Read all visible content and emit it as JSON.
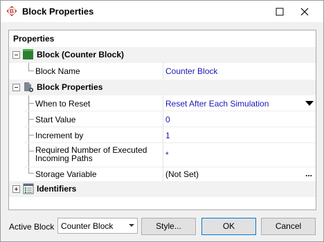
{
  "window": {
    "title": "Block Properties",
    "app_icon": "reliability-logo-icon",
    "maximize_icon": "maximize-icon",
    "close_icon": "close-icon"
  },
  "grid": {
    "header": "Properties",
    "categories": [
      {
        "label": "Block (Counter Block)",
        "icon": "green-block-icon",
        "expanded": true,
        "properties": [
          {
            "name": "Block Name",
            "value": "Counter Block"
          }
        ]
      },
      {
        "label": "Block Properties",
        "icon": "block-settings-icon",
        "expanded": true,
        "properties": [
          {
            "name": "When to Reset",
            "value": "Reset After Each Simulation",
            "editor": "dropdown"
          },
          {
            "name": "Start Value",
            "value": "0"
          },
          {
            "name": "Increment by",
            "value": "1"
          },
          {
            "name": "Required Number of Executed Incoming Paths",
            "value": "*"
          },
          {
            "name": "Storage Variable",
            "value": "(Not Set)",
            "editor": "ellipsis"
          }
        ]
      },
      {
        "label": "Identifiers",
        "icon": "identifiers-icon",
        "expanded": false,
        "properties": []
      }
    ]
  },
  "footer": {
    "active_block_label": "Active Block",
    "active_block_value": "Counter Block",
    "style_button": "Style...",
    "ok_button": "OK",
    "cancel_button": "Cancel"
  },
  "colors": {
    "value_text": "#1a1ab4",
    "category_bg": "#f2f2f2",
    "brand_red": "#c0392b",
    "block_green": "#2e7d32"
  }
}
